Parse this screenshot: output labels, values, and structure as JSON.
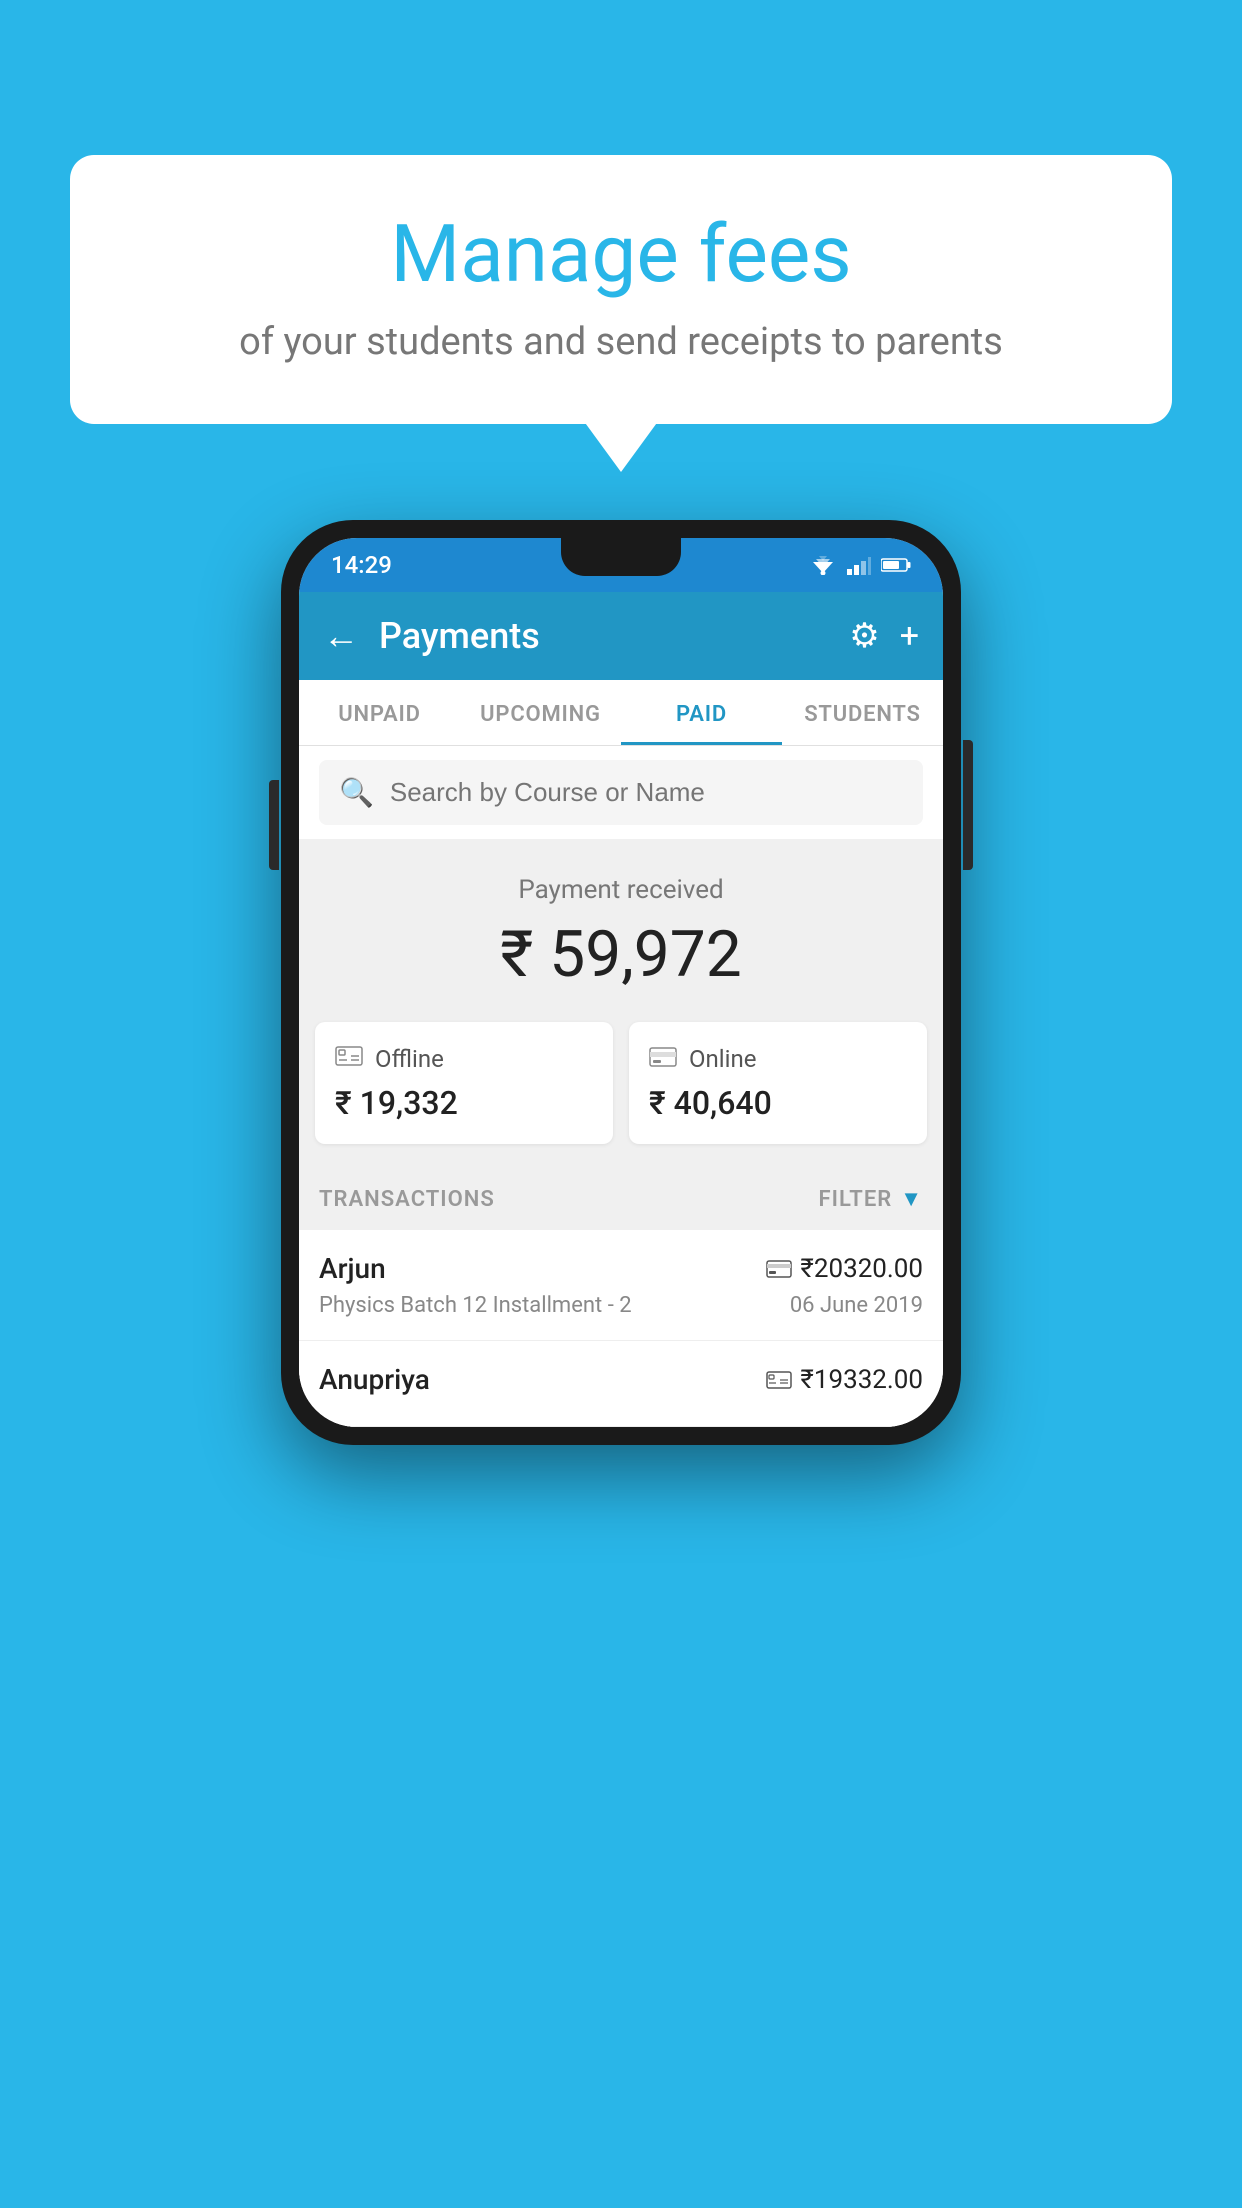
{
  "background_color": "#29b6e8",
  "bubble": {
    "title": "Manage fees",
    "subtitle": "of your students and send receipts to parents"
  },
  "phone": {
    "status_bar": {
      "time": "14:29"
    },
    "app_bar": {
      "title": "Payments",
      "back_label": "←",
      "settings_label": "⚙",
      "add_label": "+"
    },
    "tabs": [
      {
        "label": "UNPAID",
        "active": false
      },
      {
        "label": "UPCOMING",
        "active": false
      },
      {
        "label": "PAID",
        "active": true
      },
      {
        "label": "STUDENTS",
        "active": false
      }
    ],
    "search": {
      "placeholder": "Search by Course or Name"
    },
    "payment_summary": {
      "label": "Payment received",
      "amount": "₹ 59,972"
    },
    "cards": [
      {
        "icon": "offline",
        "label": "Offline",
        "amount": "₹ 19,332"
      },
      {
        "icon": "online",
        "label": "Online",
        "amount": "₹ 40,640"
      }
    ],
    "transactions_label": "TRANSACTIONS",
    "filter_label": "FILTER",
    "transactions": [
      {
        "name": "Arjun",
        "amount": "₹20320.00",
        "description": "Physics Batch 12 Installment - 2",
        "date": "06 June 2019",
        "payment_type": "online"
      },
      {
        "name": "Anupriya",
        "amount": "₹19332.00",
        "description": "",
        "date": "",
        "payment_type": "offline"
      }
    ]
  }
}
